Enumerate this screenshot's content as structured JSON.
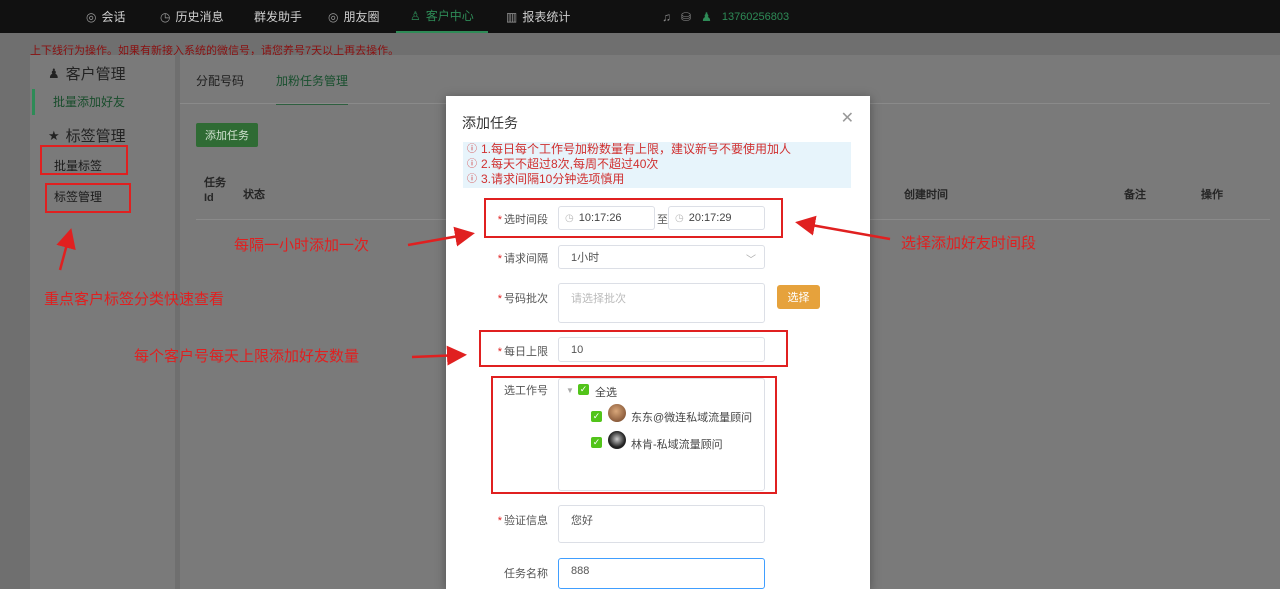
{
  "nav": {
    "items": [
      {
        "label": "会话",
        "icon": "chat-icon"
      },
      {
        "label": "历史消息",
        "icon": "clock-icon"
      },
      {
        "label": "群发助手",
        "icon": ""
      },
      {
        "label": "朋友圈",
        "icon": "camera-icon"
      },
      {
        "label": "客户中心",
        "icon": "user-icon"
      },
      {
        "label": "报表统计",
        "icon": "bar-chart-icon"
      }
    ],
    "active": "客户中心",
    "phone": "13760256803",
    "accent": "#2e8b57"
  },
  "notice": "上下线行为操作。如果有新接入系统的微信号，请您养号7天以上再去操作。",
  "sidebar": {
    "customer_title": "客户管理",
    "batch_add": "批量添加好友",
    "tag_title": "标签管理",
    "batch_tag": "批量标签",
    "tag_manage": "标签管理"
  },
  "main": {
    "tabs": [
      "分配号码",
      "加粉任务管理"
    ],
    "active_tab": "加粉任务管理",
    "add_button": "添加任务",
    "columns": [
      "任务\nId",
      "状态",
      "创建时间",
      "备注",
      "操作"
    ]
  },
  "modal": {
    "title": "添加任务",
    "tips": [
      "1.每日每个工作号加粉数量有上限，建议新号不要使用加人",
      "2.每天不超过8次,每周不超过40次",
      "3.请求间隔10分钟选项慎用"
    ],
    "time_label": "选时间段",
    "time_start": "10:17:26",
    "time_sep": "至",
    "time_end": "20:17:29",
    "interval_label": "请求间隔",
    "interval_value": "1小时",
    "batch_label": "号码批次",
    "batch_placeholder": "请选择批次",
    "select_button": "选择",
    "limit_label": "每日上限",
    "limit_value": "10",
    "worker_label": "选工作号",
    "select_all": "全选",
    "workers": [
      "东东@微连私域流量顾问",
      "林肯-私域流量顾问"
    ],
    "verify_label": "验证信息",
    "verify_value": "您好",
    "taskname_label": "任务名称",
    "taskname_value": "888"
  },
  "annotations": {
    "interval": "每隔一小时添加一次",
    "timerange": "选择添加好友时间段",
    "tags": "重点客户标签分类快速查看",
    "limit": "每个客户号每天上限添加好友数量"
  }
}
